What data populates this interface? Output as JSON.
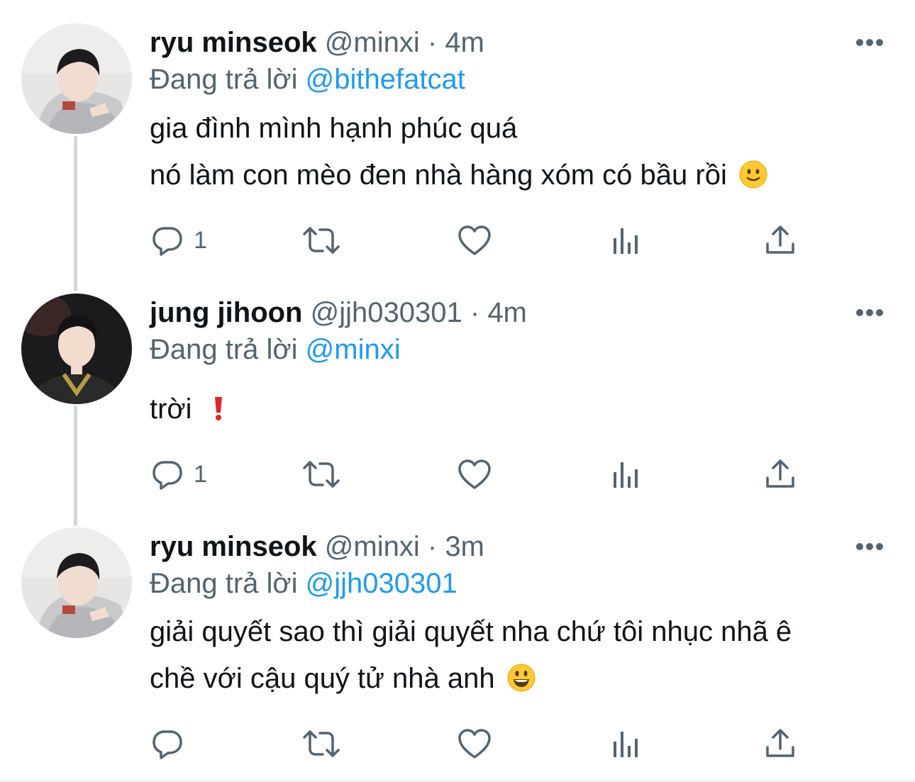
{
  "tweets": [
    {
      "name": "ryu minseok",
      "handle": "@minxi",
      "separator": "·",
      "time": "4m",
      "reply_prefix": "Đang trả lời",
      "reply_to": "@bithefatcat",
      "lines": [
        "gia đình mình hạnh phúc quá",
        "nó làm con mèo đen nhà hàng xóm có bầu rồi"
      ],
      "trailing_emoji": "slightly-smiling-face",
      "reply_count": "1"
    },
    {
      "name": "jung jihoon",
      "handle": "@jjh030301",
      "separator": "·",
      "time": "4m",
      "reply_prefix": "Đang trả lời",
      "reply_to": "@minxi",
      "lines": [
        "trời"
      ],
      "trailing_emoji": "red-exclamation-mark",
      "reply_count": "1"
    },
    {
      "name": "ryu minseok",
      "handle": "@minxi",
      "separator": "·",
      "time": "3m",
      "reply_prefix": "Đang trả lời",
      "reply_to": "@jjh030301",
      "lines": [
        "giải quyết sao thì giải quyết nha chứ tôi nhục nhã ê",
        "chề với cậu quý tử nhà anh"
      ],
      "trailing_emoji": "grinning-face",
      "reply_count": ""
    }
  ],
  "icons": [
    "more-icon",
    "reply-icon",
    "retweet-icon",
    "like-icon",
    "views-icon",
    "share-icon"
  ],
  "colors": {
    "text": "#0f1419",
    "secondary": "#536471",
    "link": "#1d9bf0",
    "thread_line": "#cfd9de"
  }
}
